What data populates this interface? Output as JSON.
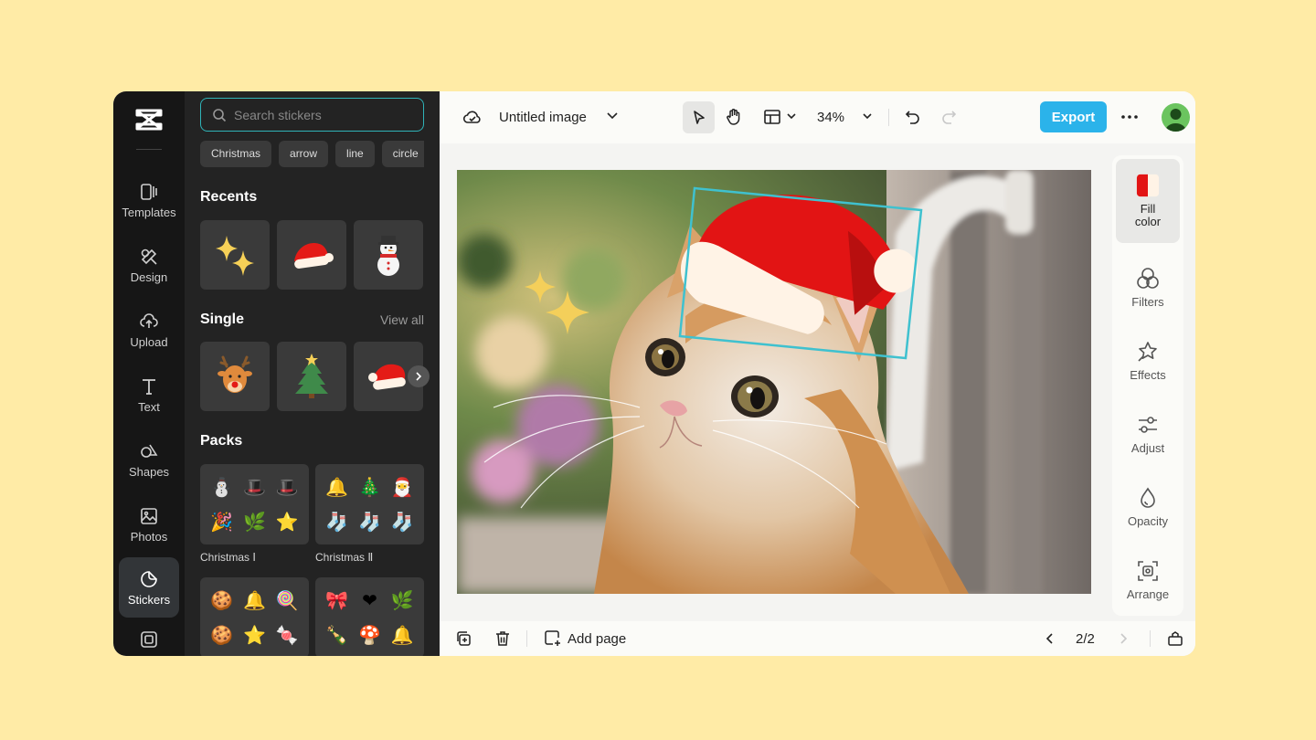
{
  "rail": {
    "items": [
      {
        "label": "Templates",
        "icon": "templates-icon"
      },
      {
        "label": "Design",
        "icon": "design-icon"
      },
      {
        "label": "Upload",
        "icon": "upload-icon"
      },
      {
        "label": "Text",
        "icon": "text-icon"
      },
      {
        "label": "Shapes",
        "icon": "shapes-icon"
      },
      {
        "label": "Photos",
        "icon": "photos-icon"
      },
      {
        "label": "Stickers",
        "icon": "stickers-icon",
        "active": true
      }
    ]
  },
  "panel": {
    "search_placeholder": "Search stickers",
    "chips": [
      "Christmas",
      "arrow",
      "line",
      "circle"
    ],
    "recents_title": "Recents",
    "single_title": "Single",
    "view_all": "View all",
    "packs_title": "Packs",
    "packs": [
      {
        "label": "Christmas Ⅰ",
        "items": [
          "⛄",
          "🎩",
          "🎩",
          "🎉",
          "🌿",
          "⭐"
        ]
      },
      {
        "label": "Christmas Ⅱ",
        "items": [
          "🔔",
          "🎄",
          "🎅",
          "🧦",
          "🧦",
          "🧦"
        ]
      },
      {
        "label": "",
        "items": [
          "🍪",
          "🔔",
          "🍭",
          "🍪",
          "⭐",
          "🍬"
        ]
      },
      {
        "label": "",
        "items": [
          "🎀",
          "❤",
          "🌿",
          "🍾",
          "🍄",
          "🔔"
        ]
      }
    ]
  },
  "topbar": {
    "doc_title": "Untitled image",
    "zoom": "34%",
    "export_label": "Export"
  },
  "right_panel": {
    "items": [
      {
        "label": "Fill color",
        "icon": "fill-color-icon"
      },
      {
        "label": "Filters",
        "icon": "filters-icon"
      },
      {
        "label": "Effects",
        "icon": "effects-icon"
      },
      {
        "label": "Adjust",
        "icon": "adjust-icon"
      },
      {
        "label": "Opacity",
        "icon": "opacity-icon"
      },
      {
        "label": "Arrange",
        "icon": "arrange-icon"
      }
    ]
  },
  "bottombar": {
    "add_page": "Add page",
    "page_indicator": "2/2"
  },
  "colors": {
    "accent": "#2bb3ea",
    "selection": "#2fb3b8",
    "background": "#ffeba6"
  }
}
